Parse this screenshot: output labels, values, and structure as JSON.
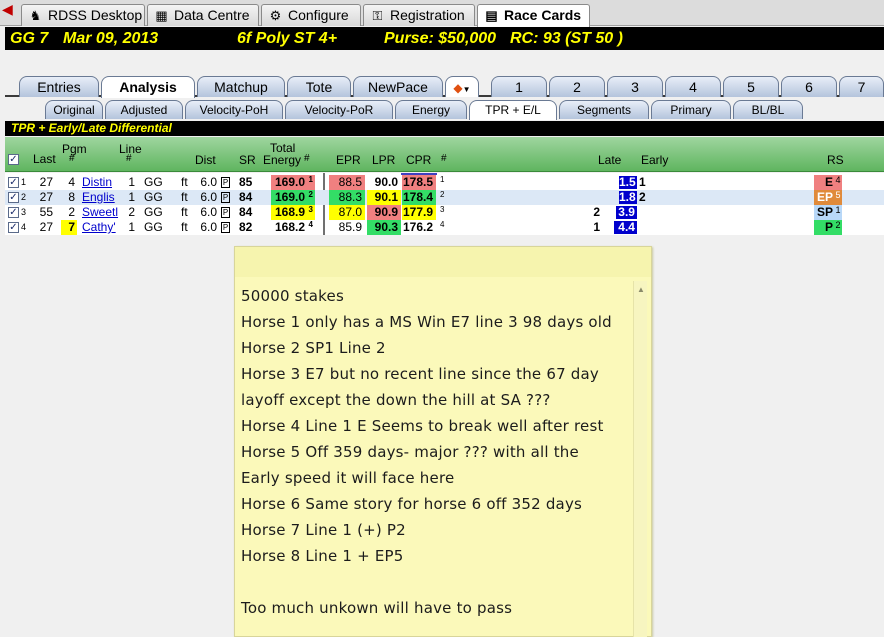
{
  "top_tabs": [
    {
      "label": "RDSS Desktop",
      "icon": "horse-icon"
    },
    {
      "label": "Data Centre",
      "icon": "table-icon"
    },
    {
      "label": "Configure",
      "icon": "gear-icon"
    },
    {
      "label": "Registration",
      "icon": "key-icon"
    },
    {
      "label": "Race Cards",
      "icon": "race-card-icon",
      "active": true
    }
  ],
  "race_header": {
    "track_race": "GG 7",
    "date": "Mar 09, 2013",
    "conditions": "6f  Poly  ST  4+",
    "purse": "Purse: $50,000",
    "rc": "RC: 93  (ST 50 )"
  },
  "main_tabs": [
    "Entries",
    "Analysis",
    "Matchup",
    "Tote",
    "NewPace"
  ],
  "main_tabs_active": "Analysis",
  "number_tabs": [
    "1",
    "2",
    "3",
    "4",
    "5",
    "6",
    "7"
  ],
  "sub_tabs": [
    "Original",
    "Adjusted",
    "Velocity-PoH",
    "Velocity-PoR",
    "Energy",
    "TPR + E/L",
    "Segments",
    "Primary",
    "BL/BL"
  ],
  "sub_tabs_active": "TPR + E/L",
  "section_title": "TPR + Early/Late Differential",
  "columns": {
    "last": "Last",
    "pgm": "Pgm",
    "pgm_hash": "#",
    "line": "Line",
    "line_hash": "#",
    "dist": "Dist",
    "sr": "SR",
    "total_energy_1": "Total",
    "total_energy_2": "Energy",
    "energy_hash": "#",
    "epr": "EPR",
    "lpr": "LPR",
    "cpr": "CPR",
    "cpr_hash": "#",
    "late": "Late",
    "early": "Early",
    "rs": "RS"
  },
  "rows": [
    {
      "idx": "1",
      "last": "27",
      "pgm": "4",
      "name": "Distin",
      "line": "1",
      "track": "GG",
      "surf": "ft",
      "dist": "6.0",
      "p": "P",
      "sr": "85",
      "energy": "169.0",
      "energy_rank": "1",
      "epr": "88.5",
      "lpr": "90.0",
      "cpr": "178.5",
      "cpr_rank": "1",
      "late_rank": "",
      "late": "1.5",
      "late_value": 1.5,
      "early": "1",
      "rs": "E",
      "rs_num": "4"
    },
    {
      "idx": "2",
      "last": "27",
      "pgm": "8",
      "name": "Englis",
      "line": "1",
      "track": "GG",
      "surf": "ft",
      "dist": "6.0",
      "p": "P",
      "sr": "84",
      "energy": "169.0",
      "energy_rank": "2",
      "epr": "88.3",
      "lpr": "90.1",
      "cpr": "178.4",
      "cpr_rank": "2",
      "late_rank": "",
      "late": "1.8",
      "late_value": 1.8,
      "early": "2",
      "rs": "EP",
      "rs_num": "5"
    },
    {
      "idx": "3",
      "last": "55",
      "pgm": "2",
      "name": "Sweetl",
      "line": "2",
      "track": "GG",
      "surf": "ft",
      "dist": "6.0",
      "p": "P",
      "sr": "84",
      "energy": "168.9",
      "energy_rank": "3",
      "epr": "87.0",
      "lpr": "90.9",
      "cpr": "177.9",
      "cpr_rank": "3",
      "late_rank": "2",
      "late": "3.9",
      "late_value": 3.9,
      "early": "",
      "rs": "SP",
      "rs_num": "1"
    },
    {
      "idx": "4",
      "last": "27",
      "pgm": "7",
      "name": "Cathy'",
      "line": "1",
      "track": "GG",
      "surf": "ft",
      "dist": "6.0",
      "p": "P",
      "sr": "82",
      "energy": "168.2",
      "energy_rank": "4",
      "epr": "85.9",
      "lpr": "90.3",
      "cpr": "176.2",
      "cpr_rank": "4",
      "late_rank": "1",
      "late": "4.4",
      "late_value": 4.4,
      "early": "",
      "rs": "P",
      "rs_num": "2"
    }
  ],
  "note_lines": [
    "50000 stakes",
    "Horse 1 only has a MS Win E7 line 3 98 days old",
    "Horse 2 SP1 Line 2",
    "Horse 3 E7 but no recent line since the 67 day",
    "layoff except the down the hill at SA ???",
    "Horse 4 Line 1 E Seems to break well after  rest",
    "Horse 5 Off 359 days- major ??? with all the",
    "Early speed it will face here",
    "Horse 6 Same story for horse 6  off 352 days",
    "Horse 7 Line 1 (+)  P2",
    "Horse 8 Line 1 + EP5",
    "",
    "Too much unkown will have to pass"
  ],
  "colors": {
    "header_bg": "#000000",
    "header_text": "#ffff00",
    "grid_header_green": "#7fc77f",
    "energy_rank1": "#f08080",
    "energy_rank2": "#33dd66",
    "energy_rank3": "#ffff00",
    "late_bar": "#0000cc",
    "note_bg": "#fbf9ba"
  }
}
